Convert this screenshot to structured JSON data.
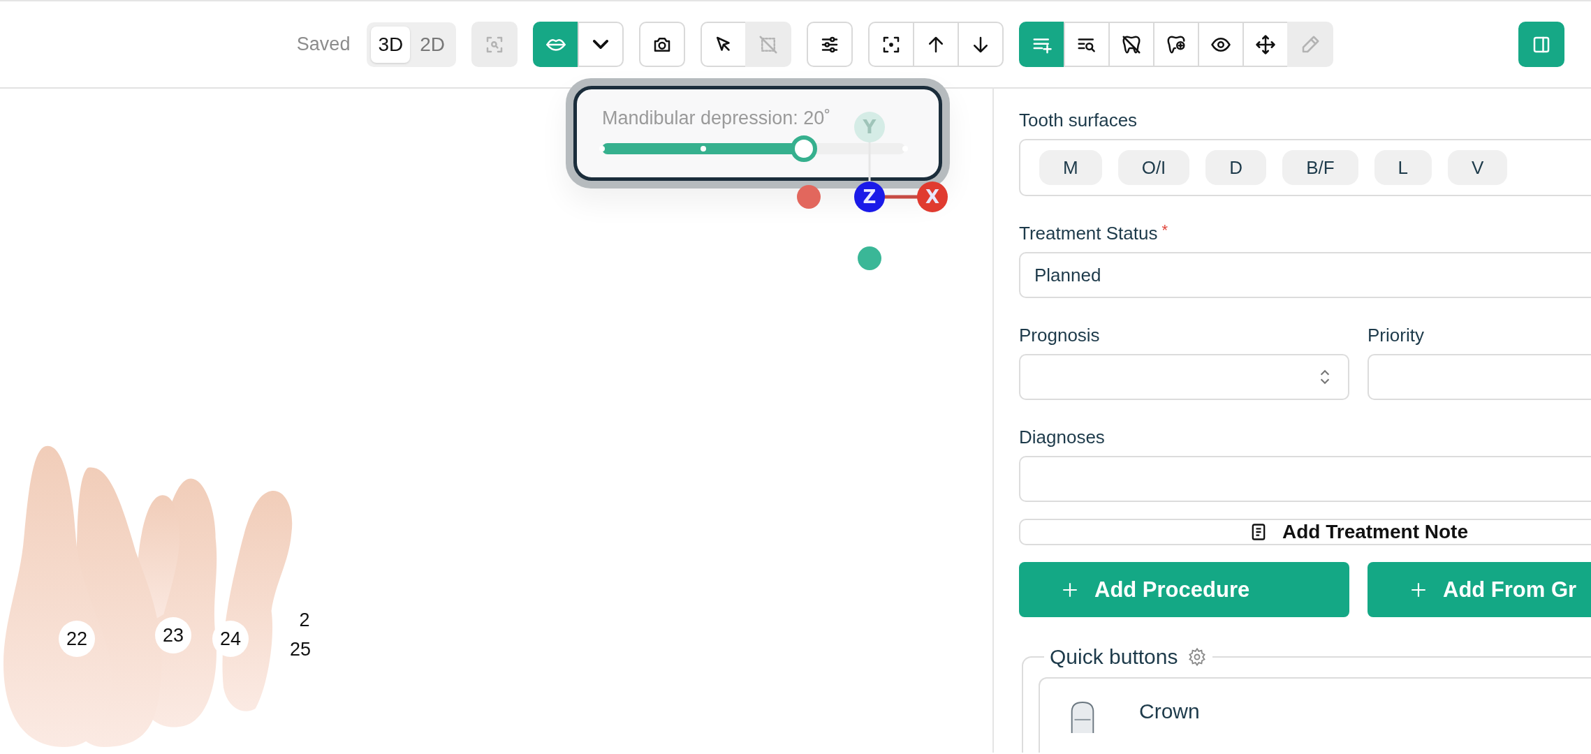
{
  "toolbar": {
    "save_status": "Saved",
    "view_modes": [
      {
        "label": "3D",
        "selected": true
      },
      {
        "label": "2D",
        "selected": false
      }
    ],
    "tool_groups": [
      [
        {
          "kind": "scan",
          "selected": false,
          "disabled": true
        }
      ],
      [
        {
          "kind": "lips",
          "selected": true,
          "disabled": false
        },
        {
          "kind": "chevron",
          "selected": false,
          "disabled": false
        }
      ],
      [
        {
          "kind": "camera",
          "selected": false,
          "disabled": false
        }
      ],
      [
        {
          "kind": "cursor",
          "selected": false,
          "disabled": false
        },
        {
          "kind": "deselect",
          "selected": false,
          "disabled": true
        }
      ],
      [
        {
          "kind": "sliders",
          "selected": false,
          "disabled": false
        }
      ],
      [
        {
          "kind": "focus",
          "selected": false,
          "disabled": false
        },
        {
          "kind": "up",
          "selected": false,
          "disabled": false
        },
        {
          "kind": "down",
          "selected": false,
          "disabled": false
        }
      ],
      [
        {
          "kind": "list-add",
          "selected": true,
          "disabled": false
        },
        {
          "kind": "list-search",
          "selected": false,
          "disabled": false
        },
        {
          "kind": "tooth-off",
          "selected": false,
          "disabled": false
        },
        {
          "kind": "tooth-add",
          "selected": false,
          "disabled": false
        },
        {
          "kind": "eye",
          "selected": false,
          "disabled": false
        },
        {
          "kind": "move",
          "selected": false,
          "disabled": false
        },
        {
          "kind": "pencil",
          "selected": false,
          "disabled": true
        }
      ],
      [
        {
          "kind": "panel",
          "selected": true,
          "disabled": false
        }
      ]
    ]
  },
  "viewport": {
    "popover": {
      "label": "Mandibular depression: 20˚",
      "level": 0.667
    },
    "gizmo": [
      {
        "label": "Y",
        "color": "#d5ece6"
      },
      {
        "label": "Z",
        "color": "#1a1ae8"
      },
      {
        "label": "X",
        "color": "#e03b30"
      }
    ],
    "tooth_labels": [
      {
        "text": "22",
        "kind": "badge"
      },
      {
        "text": "23",
        "kind": "badge"
      },
      {
        "text": "24",
        "kind": "badge"
      },
      {
        "text": "2",
        "kind": "plain"
      },
      {
        "text": "25",
        "kind": "plain"
      }
    ]
  },
  "panel": {
    "tooth_surfaces": {
      "label": "Tooth surfaces",
      "chips": [
        {
          "label": "M",
          "selected": false
        },
        {
          "label": "O/I",
          "selected": false
        },
        {
          "label": "D",
          "selected": false
        },
        {
          "label": "B/F",
          "selected": false
        },
        {
          "label": "L",
          "selected": false
        },
        {
          "label": "V",
          "selected": false
        }
      ]
    },
    "treatment_status": {
      "label": "Treatment Status",
      "required_mark": "*",
      "value": "Planned"
    },
    "prognosis": {
      "label": "Prognosis"
    },
    "priority": {
      "label": "Priority"
    },
    "diagnoses": {
      "label": "Diagnoses"
    },
    "note_button": "Add Treatment Note",
    "actions": [
      "Add Procedure",
      "Add From Gr"
    ],
    "quick_buttons": {
      "title": "Quick buttons",
      "items": [
        {
          "label": "Crown"
        }
      ]
    }
  }
}
